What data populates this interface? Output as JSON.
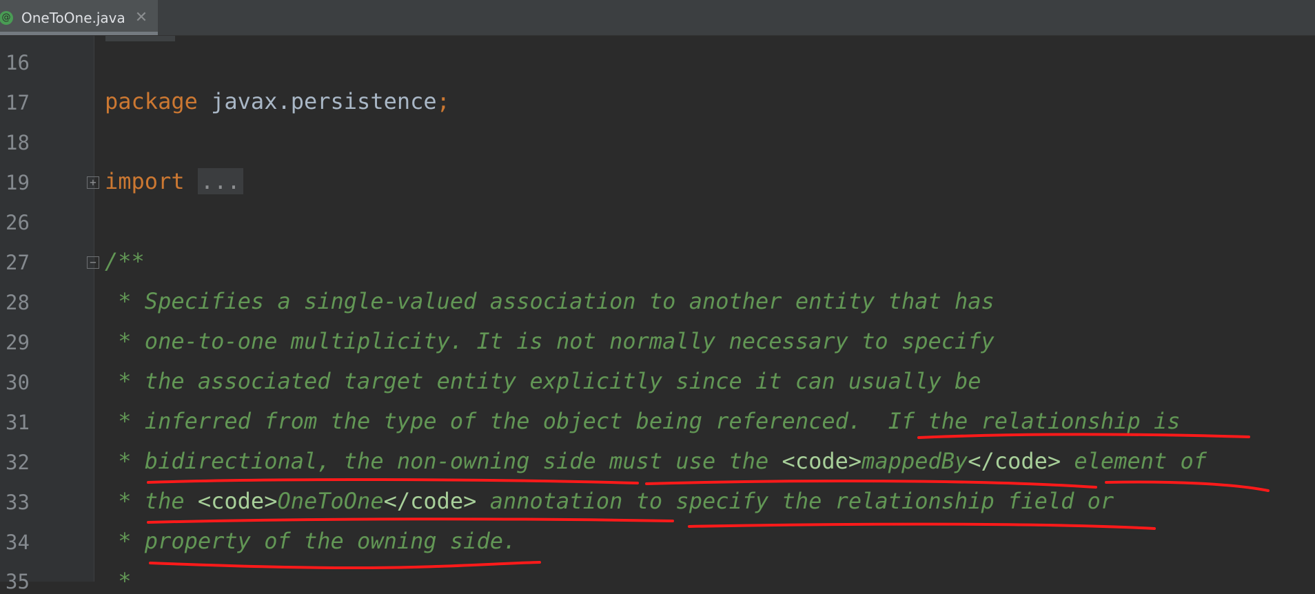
{
  "tab": {
    "icon_glyph": "@",
    "title": "OneToOne.java",
    "close_glyph": "✕"
  },
  "editor": {
    "lines": [
      {
        "num": "16"
      },
      {
        "num": "17",
        "kw": "package",
        "rest": " javax.persistence",
        "semi": ";"
      },
      {
        "num": "18"
      },
      {
        "num": "19",
        "kw": "import",
        "folded": "..."
      },
      {
        "num": "26"
      },
      {
        "num": "27",
        "doc": "/**"
      },
      {
        "num": "28",
        "doc": " * Specifies a single-valued association to another entity that has"
      },
      {
        "num": "29",
        "doc": " * one-to-one multiplicity. It is not normally necessary to specify"
      },
      {
        "num": "30",
        "doc": " * the associated target entity explicitly since it can usually be"
      },
      {
        "num": "31",
        "doc": " * inferred from the type of the object being referenced.  If the relationship is"
      },
      {
        "num": "32",
        "doc_a": " * bidirectional, the non-owning side must use the ",
        "tag1": "<code>",
        "doc_b": "mappedBy",
        "tag2": "</code>",
        "doc_c": " element of"
      },
      {
        "num": "33",
        "doc_a": " * the ",
        "tag1": "<code>",
        "doc_b": "OneToOne",
        "tag2": "</code>",
        "doc_c": " annotation to specify the relationship field or"
      },
      {
        "num": "34",
        "doc": " * property of the owning side."
      },
      {
        "num": "35",
        "doc": " *"
      }
    ]
  },
  "colors": {
    "keyword": "#cc7832",
    "doc_comment": "#629755",
    "annotation_marks": "#ff1a1a"
  }
}
